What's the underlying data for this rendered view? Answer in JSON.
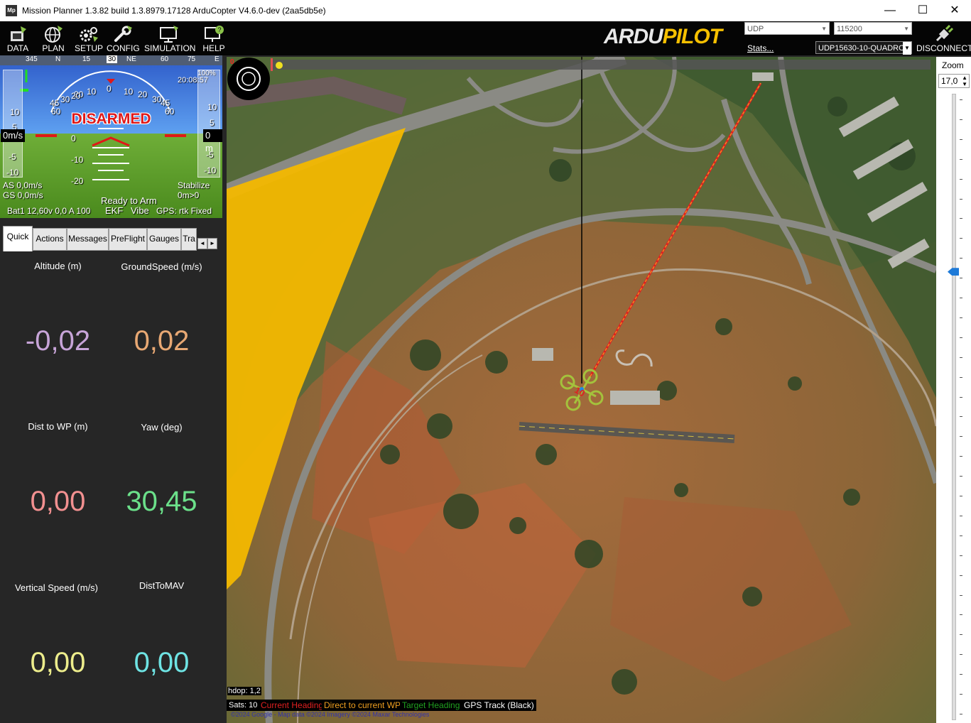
{
  "window": {
    "title": "Mission Planner 1.3.82 build 1.3.8979.17128 ArduCopter V4.6.0-dev (2aa5db5e)",
    "icon_text": "Mp",
    "minimize": "—",
    "maximize": "☐",
    "close": "✕"
  },
  "toolbar": {
    "items": [
      {
        "label": "DATA",
        "icon": "data-icon"
      },
      {
        "label": "PLAN",
        "icon": "globe-icon"
      },
      {
        "label": "SETUP",
        "icon": "gears-icon"
      },
      {
        "label": "CONFIG",
        "icon": "wrench-icon"
      },
      {
        "label": "SIMULATION",
        "icon": "monitor-icon"
      },
      {
        "label": "HELP",
        "icon": "help-icon"
      }
    ],
    "logo_ardu": "ARDU",
    "logo_pilot": "PILOT",
    "connection_type": "UDP",
    "baud_rate": "115200",
    "stats_link": "Stats...",
    "link_name": "UDP15630-10-QUADRO",
    "disconnect_label": "DISCONNECT",
    "accent": "#f6c000"
  },
  "hud": {
    "heading_labels": [
      "345",
      "N",
      "15",
      "30",
      "NE",
      "60",
      "75",
      "E"
    ],
    "pitch_left": [
      "20",
      "10",
      "0",
      "-10",
      "-20"
    ],
    "pitch_right": [
      "10",
      "0",
      "-10",
      "-20"
    ],
    "roll_labels": [
      "60",
      "45",
      "30",
      "20",
      "10",
      "0",
      "10",
      "20",
      "30",
      "45",
      "60"
    ],
    "status": "DISARMED",
    "time": "20:08:57",
    "top_right": "100%",
    "speed_tape": [
      "10",
      "5",
      "-5",
      "-10"
    ],
    "alt_tape": [
      "10",
      "5",
      "-5",
      "-10"
    ],
    "speed_box": "0m/s",
    "alt_box": "0 m",
    "airspeed": "AS 0,0m/s",
    "groundspeed": "GS 0,0m/s",
    "ready": "Ready to Arm",
    "mode": "Stabilize",
    "dist_home": "0m>0",
    "battery": "Bat1 12,60v 0,0 A 100",
    "ekf": "EKF",
    "vibe": "Vibe",
    "gps": "GPS: rtk Fixed",
    "status_color": "#e01818"
  },
  "tabs": [
    "Quick",
    "Actions",
    "Messages",
    "PreFlight",
    "Gauges",
    "Tra"
  ],
  "tab_arrow_left": "◄",
  "tab_arrow_right": "►",
  "quick": [
    {
      "label": "Altitude (m)",
      "value": "-0,02",
      "color": "#c7a4d8"
    },
    {
      "label": "GroundSpeed (m/s)",
      "value": "0,02",
      "color": "#e8a873"
    },
    {
      "label": "Dist to WP (m)",
      "value": "0,00",
      "color": "#f29090"
    },
    {
      "label": "Yaw (deg)",
      "value": "30,45",
      "color": "#6be08a"
    },
    {
      "label": "Vertical Speed (m/s)",
      "value": "0,00",
      "color": "#eded8c"
    },
    {
      "label": "DistToMAV",
      "value": "0,00",
      "color": "#6ee3e3"
    }
  ],
  "map": {
    "counter": "0",
    "hdop": "hdop: 1,2",
    "sats": "Sats: 10",
    "vehicle_label": "10",
    "copyright": "©2024 Google - Map data ©2024 Imagery ©2024 Maxar Technologies",
    "legend": [
      {
        "label": "Current Heading",
        "color": "#e02020"
      },
      {
        "label": "Direct to current WP",
        "color": "#f0a020"
      },
      {
        "label": "Target Heading",
        "color": "#20a020"
      },
      {
        "label": "GPS Track (Black)",
        "color": "#ffffff"
      }
    ]
  },
  "zoom": {
    "label": "Zoom",
    "value": "17,0",
    "slider_level": 0.72
  }
}
